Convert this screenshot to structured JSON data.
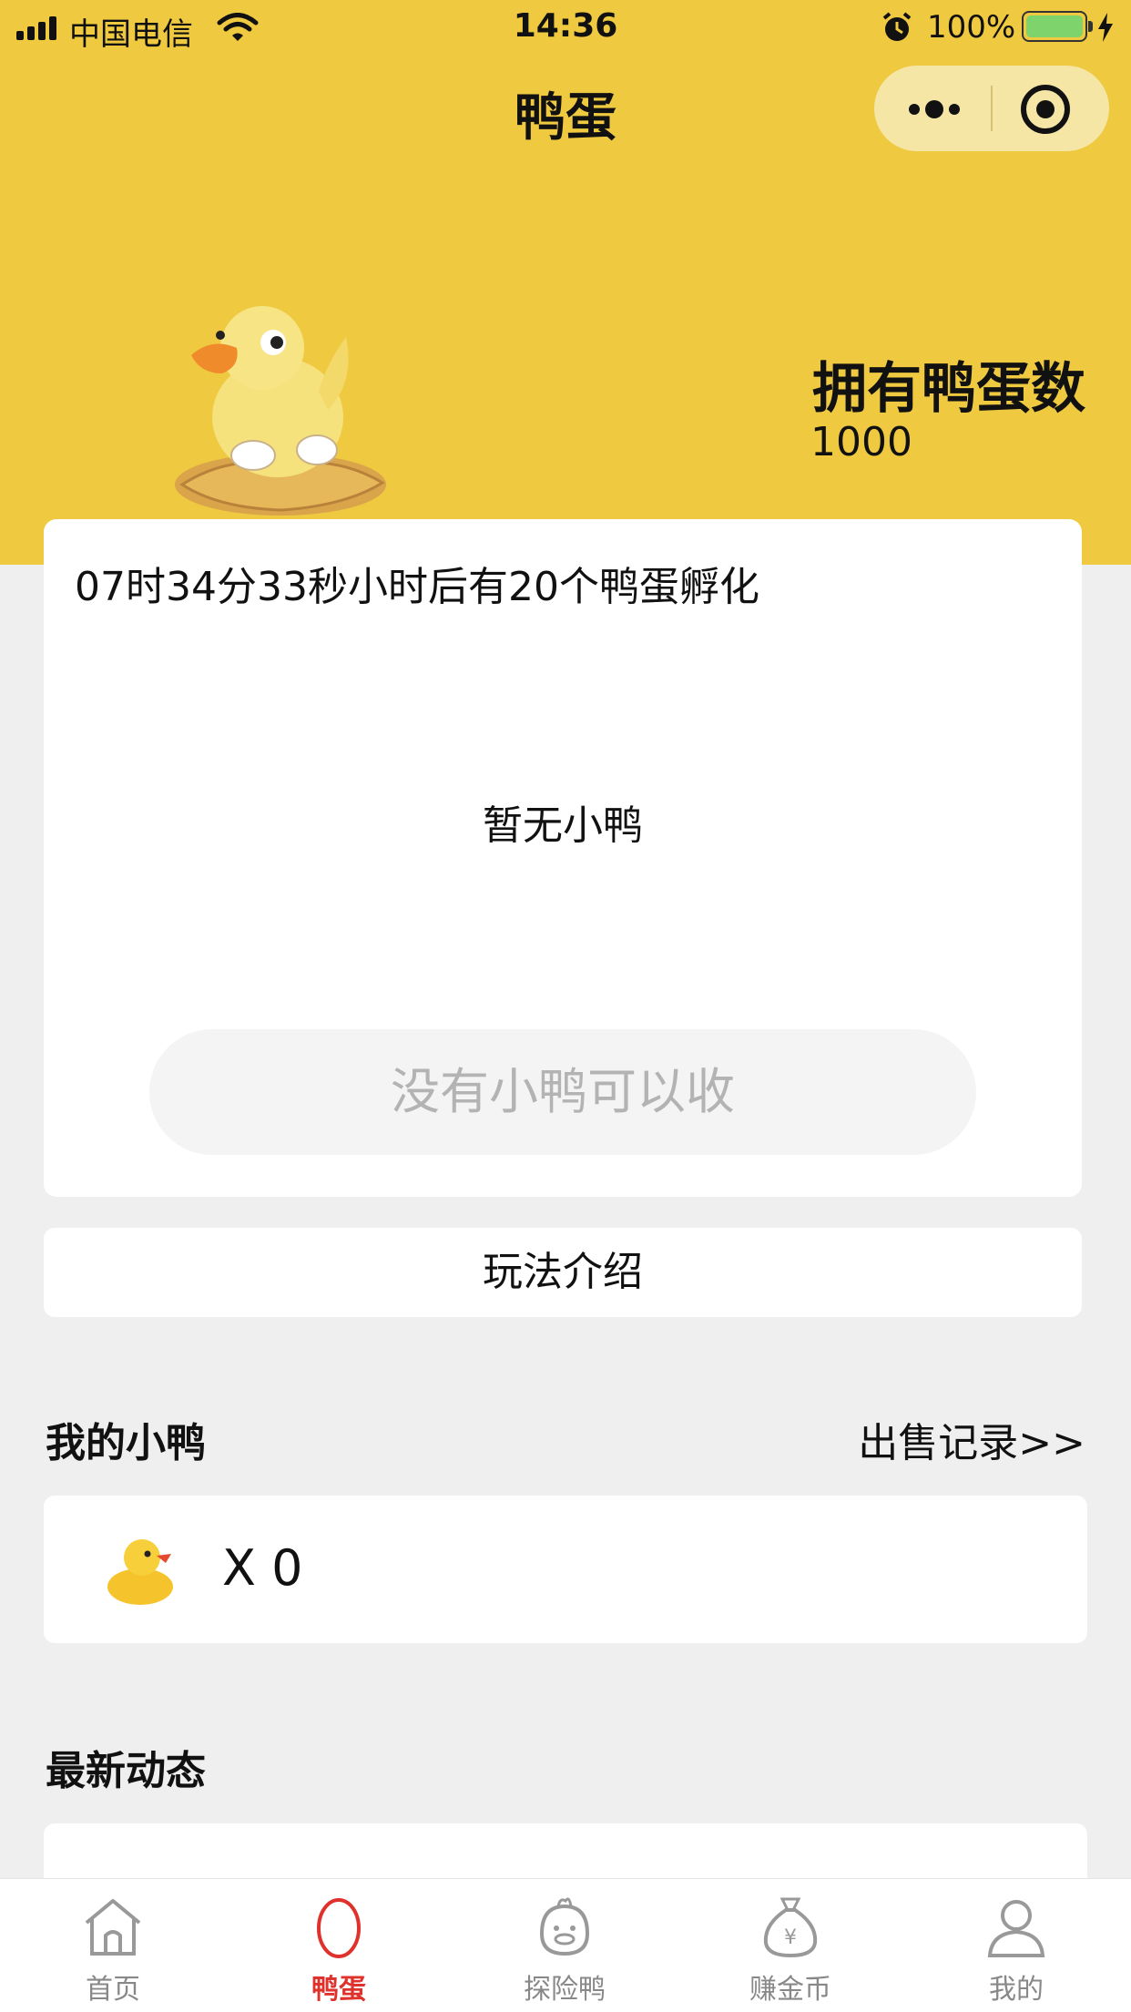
{
  "status_bar": {
    "carrier": "中国电信",
    "time": "14:36",
    "battery_percent": "100%"
  },
  "nav": {
    "title": "鸭蛋",
    "more_icon": "more-dots-icon",
    "close_icon": "target-circle-icon"
  },
  "hero": {
    "egg_label": "拥有鸭蛋数",
    "egg_count": "1000",
    "background_color": "#efc940"
  },
  "hatch_card": {
    "countdown_text": "07时34分33秒小时后有20个鸭蛋孵化",
    "empty_text": "暂无小鸭",
    "collect_button": "没有小鸭可以收"
  },
  "rules_button": "玩法介绍",
  "my_ducks": {
    "title": "我的小鸭",
    "sale_record_link": "出售记录>>",
    "count_text": "X 0"
  },
  "news": {
    "title": "最新动态"
  },
  "tabbar": {
    "active_color": "#e0322d",
    "items": [
      {
        "label": "首页",
        "icon": "home-icon"
      },
      {
        "label": "鸭蛋",
        "icon": "egg-icon"
      },
      {
        "label": "探险鸭",
        "icon": "duck-face-icon"
      },
      {
        "label": "赚金币",
        "icon": "money-bag-icon"
      },
      {
        "label": "我的",
        "icon": "user-icon"
      }
    ]
  }
}
